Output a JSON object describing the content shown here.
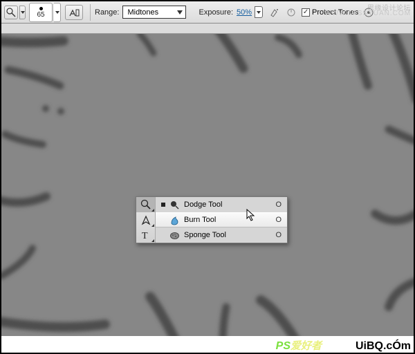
{
  "options_bar": {
    "brush_size": "65",
    "range_label": "Range:",
    "range_value": "Midtones",
    "exposure_label": "Exposure:",
    "exposure_value": "50%",
    "protect_tones_label": "Protect Tones"
  },
  "flyout": {
    "items": [
      {
        "label": "Dodge Tool",
        "shortcut": "O",
        "icon": "dodge"
      },
      {
        "label": "Burn Tool",
        "shortcut": "O",
        "icon": "burn"
      },
      {
        "label": "Sponge Tool",
        "shortcut": "O",
        "icon": "sponge"
      }
    ],
    "selected_index": 1
  },
  "watermarks": {
    "header_cn": "思缘设计论坛",
    "header_url": "WWW.MISSYUAN.COM",
    "footer_left_ps": "PS",
    "footer_left_cn": "爱好者",
    "footer_right": "UiBQ.cÓm"
  }
}
